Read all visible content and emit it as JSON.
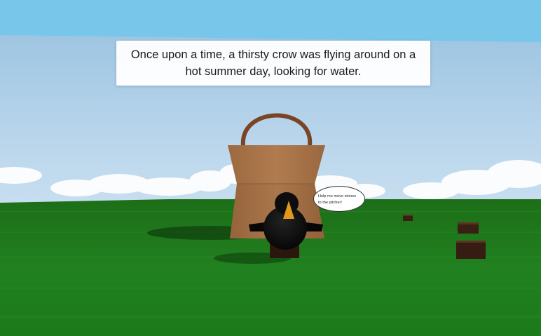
{
  "story": {
    "text": "Once upon a time, a thirsty crow was flying around on a hot summer day, looking for water."
  },
  "speech_bubble": {
    "text": "Help me move stones to the pitcher!"
  },
  "colors": {
    "sky_top": "#7ec7e8",
    "sky_horizon": "#b8dcf0",
    "grass": "#1f7a1f",
    "pitcher": "#a8754a",
    "pitcher_handle": "#7a4a28",
    "crow": "#0b0b0b",
    "beak": "#e09a1a",
    "stone": "#3a1f14"
  }
}
